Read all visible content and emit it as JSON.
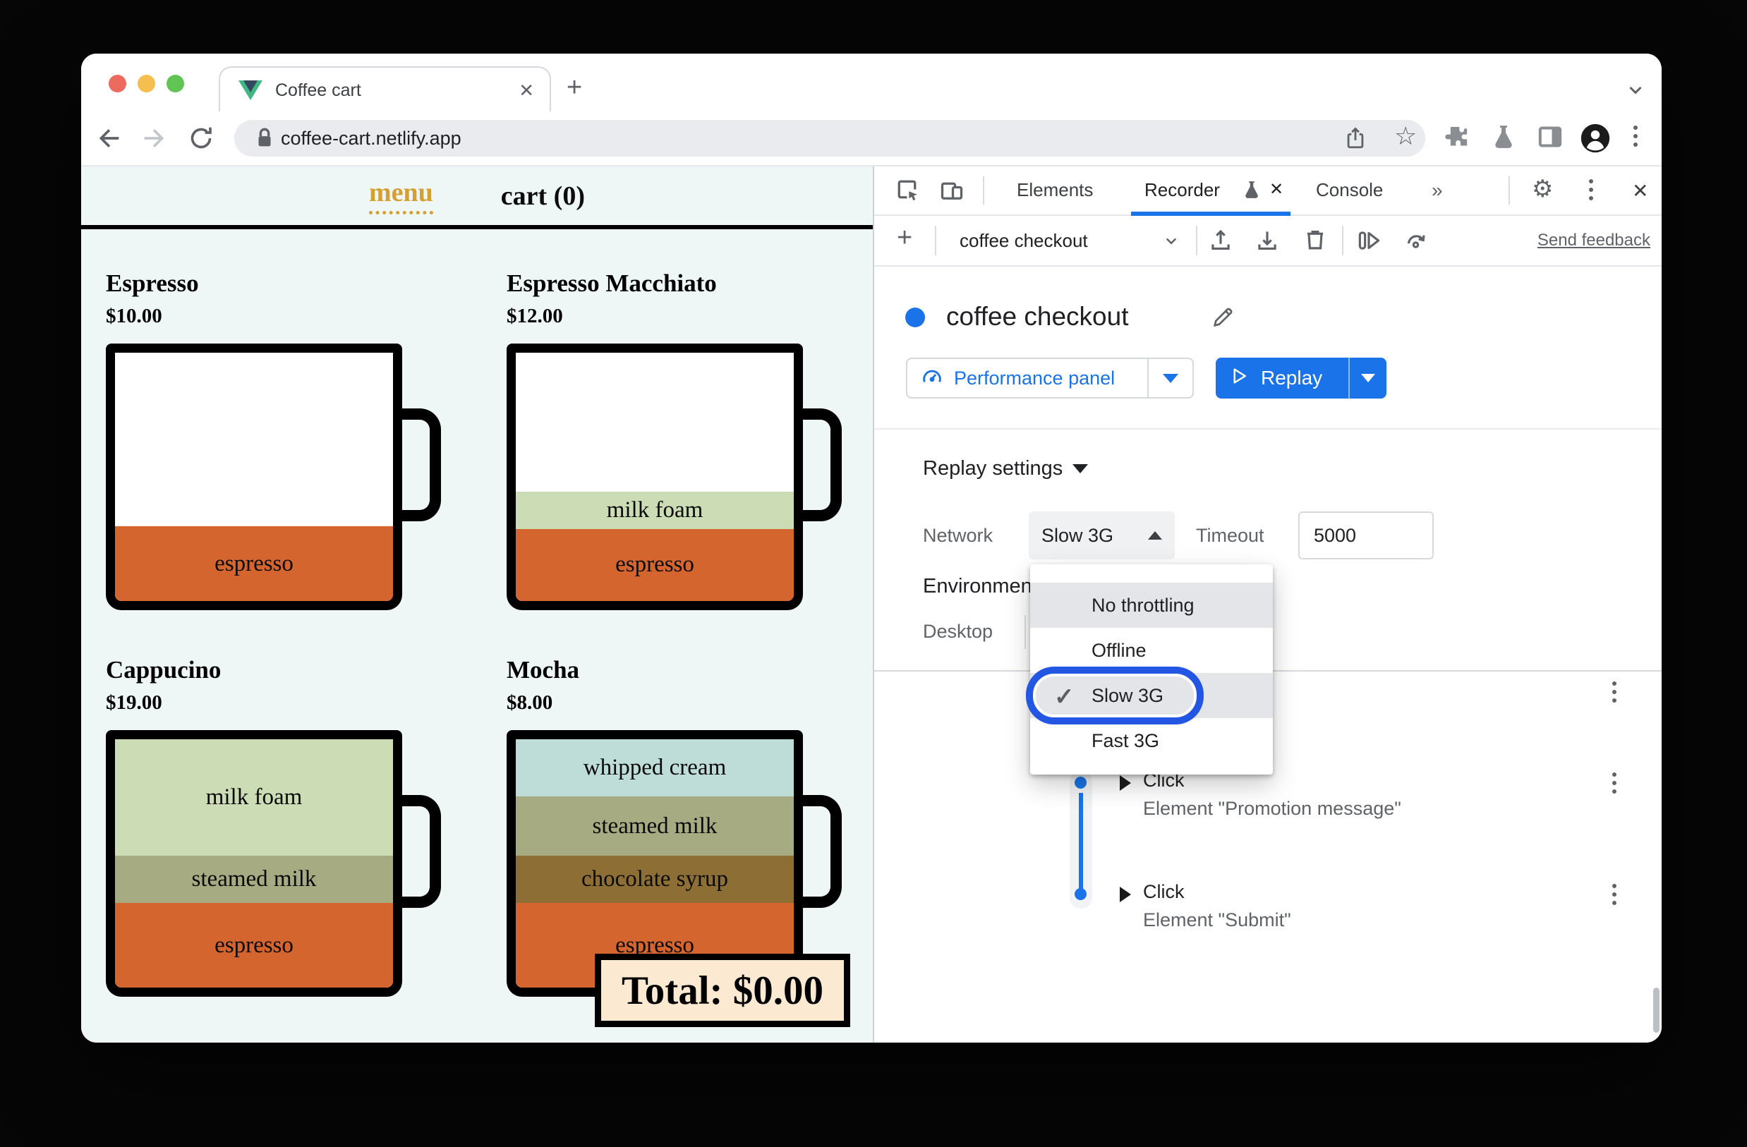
{
  "browser": {
    "tab_title": "Coffee cart",
    "url": "coffee-cart.netlify.app"
  },
  "coffee_app": {
    "nav": {
      "menu": "menu",
      "cart": "cart (0)"
    },
    "products": [
      {
        "name": "Espresso",
        "price": "$10.00",
        "empty_pct": 70,
        "layers": [
          {
            "label": "espresso",
            "color": "#d5652f",
            "pct": 30
          }
        ]
      },
      {
        "name": "Espresso Macchiato",
        "price": "$12.00",
        "empty_pct": 56,
        "layers": [
          {
            "label": "milk foam",
            "color": "#ccdcb4",
            "pct": 15
          },
          {
            "label": "espresso",
            "color": "#d5652f",
            "pct": 29
          }
        ]
      },
      {
        "name": "Cappucino",
        "price": "$19.00",
        "empty_pct": 0,
        "layers": [
          {
            "label": "milk foam",
            "color": "#ccdcb4",
            "pct": 47
          },
          {
            "label": "steamed milk",
            "color": "#a6ab81",
            "pct": 19
          },
          {
            "label": "espresso",
            "color": "#d5652f",
            "pct": 34
          }
        ]
      },
      {
        "name": "Mocha",
        "price": "$8.00",
        "empty_pct": 0,
        "layers": [
          {
            "label": "whipped cream",
            "color": "#bedcd8",
            "pct": 23
          },
          {
            "label": "steamed milk",
            "color": "#a6ab81",
            "pct": 24
          },
          {
            "label": "chocolate syrup",
            "color": "#8d6e35",
            "pct": 19
          },
          {
            "label": "espresso",
            "color": "#d5652f",
            "pct": 34
          }
        ]
      }
    ],
    "total": "Total: $0.00"
  },
  "devtools": {
    "tabs": {
      "elements": "Elements",
      "recorder": "Recorder",
      "console": "Console",
      "more": "»"
    },
    "toolbar": {
      "recording_name": "coffee checkout",
      "send_feedback": "Send feedback"
    },
    "recording": {
      "title": "coffee checkout",
      "performance_button": "Performance panel",
      "replay_button": "Replay"
    },
    "replay_settings": {
      "label": "Replay settings",
      "network_label": "Network",
      "network_value": "Slow 3G",
      "timeout_label": "Timeout",
      "timeout_value": "5000",
      "environment_label": "Environment",
      "device_label": "Desktop"
    },
    "network_dropdown": {
      "selected": "Slow 3G",
      "items": [
        {
          "label": "No throttling",
          "shaded": true,
          "checked": false,
          "focused": false
        },
        {
          "label": "Offline",
          "shaded": false,
          "checked": false,
          "focused": false
        },
        {
          "label": "Slow 3G",
          "shaded": true,
          "checked": true,
          "focused": true
        },
        {
          "label": "Fast 3G",
          "shaded": false,
          "checked": false,
          "focused": false
        }
      ]
    },
    "steps": [
      {
        "action": "Click",
        "target": "Element \"Promotion message\""
      },
      {
        "action": "Click",
        "target": "Element \"Submit\""
      }
    ],
    "colors": {
      "accent_blue": "#1a73e8",
      "focus_ring": "#2456e4"
    }
  }
}
